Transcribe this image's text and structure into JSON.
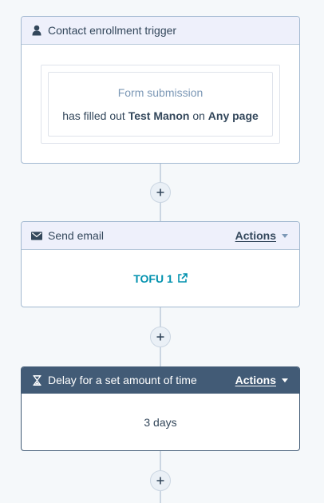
{
  "trigger": {
    "header_title": "Contact enrollment trigger",
    "type_label": "Form submission",
    "prefix": "has filled out",
    "form_name": "Test Manon",
    "connector_word": "on",
    "page": "Any page"
  },
  "steps": [
    {
      "header_title": "Send email",
      "actions_label": "Actions",
      "email_name": "TOFU 1"
    },
    {
      "header_title": "Delay for a set amount of time",
      "actions_label": "Actions",
      "delay_value": "3 days"
    }
  ],
  "icons": {
    "trigger": "contact-person-icon",
    "email": "envelope-icon",
    "delay": "hourglass-icon",
    "add": "plus-icon",
    "external": "external-link-icon"
  },
  "colors": {
    "link": "#0091ae",
    "dark_header": "#425b76",
    "light_header": "#eef0fb"
  }
}
